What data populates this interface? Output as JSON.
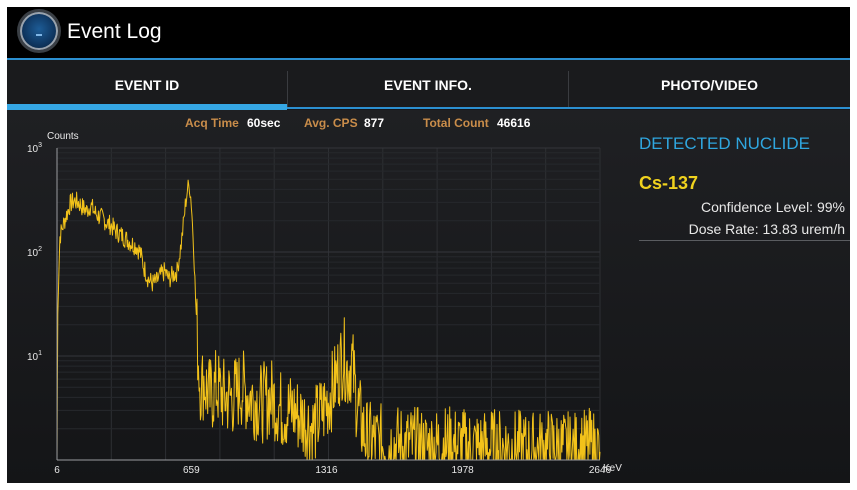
{
  "header": {
    "title": "Event Log",
    "icon": "app-dial-icon"
  },
  "tabs": [
    {
      "label": "EVENT ID",
      "active": true
    },
    {
      "label": "EVENT INFO.",
      "active": false
    },
    {
      "label": "PHOTO/VIDEO",
      "active": false
    }
  ],
  "stats": {
    "acq_time_label": "Acq Time",
    "acq_time_value": "60sec",
    "avg_cps_label": "Avg. CPS",
    "avg_cps_value": "877",
    "total_count_label": "Total Count",
    "total_count_value": "46616"
  },
  "nuclide": {
    "heading": "DETECTED NUCLIDE",
    "name": "Cs-137",
    "confidence": "Confidence Level: 99%",
    "dose_rate": "Dose Rate: 13.83 urem/h"
  },
  "colors": {
    "accent": "#2fa6df",
    "spectrum": "#f2c21a",
    "nuclide": "#f0d21e",
    "stat_label": "#c98d4a"
  },
  "chart_data": {
    "type": "line",
    "ylabel": "Counts",
    "xlabel": "KeV",
    "yscale": "log",
    "y_ticks": [
      {
        "base": "10",
        "exp": "1",
        "value": 10
      },
      {
        "base": "10",
        "exp": "2",
        "value": 100
      },
      {
        "base": "10",
        "exp": "3",
        "value": 1000
      }
    ],
    "x_ticks": [
      "6",
      "659",
      "1316",
      "1978",
      "2646"
    ],
    "xlim": [
      6,
      2646
    ],
    "ylim": [
      1,
      1000
    ],
    "grid": true,
    "series": [
      {
        "x": [
          6,
          10,
          20,
          35,
          50,
          70,
          90,
          110,
          130,
          150,
          170,
          190,
          210,
          230,
          250,
          270,
          290,
          310,
          330,
          350,
          370,
          390,
          410,
          430,
          450,
          470,
          490,
          510,
          530,
          550,
          570,
          590,
          600,
          610,
          620,
          630,
          640,
          650,
          659,
          670,
          680,
          690,
          700,
          710,
          720,
          730,
          750,
          780,
          820,
          860,
          900,
          950,
          1000,
          1050,
          1100,
          1150,
          1200,
          1250,
          1300,
          1350,
          1380,
          1400,
          1420,
          1440,
          1460,
          1480,
          1500,
          1520,
          1550,
          1600,
          1700,
          1800,
          1900,
          2000,
          2100,
          2200,
          2300,
          2400,
          2500,
          2600,
          2646
        ],
        "y": [
          1,
          30,
          140,
          180,
          220,
          290,
          310,
          300,
          270,
          250,
          280,
          240,
          220,
          210,
          190,
          180,
          160,
          150,
          140,
          130,
          120,
          115,
          100,
          70,
          55,
          50,
          52,
          60,
          65,
          55,
          60,
          65,
          90,
          120,
          180,
          280,
          400,
          440,
          300,
          120,
          35,
          12,
          6,
          5,
          6,
          5,
          4,
          5,
          4,
          4,
          5,
          4,
          3.5,
          4,
          3,
          3,
          2.5,
          2,
          3,
          5,
          8,
          10,
          7,
          9,
          4,
          2.5,
          1.8,
          1.5,
          1.5,
          1.4,
          1.4,
          1.3,
          1.4,
          1.3,
          1.3,
          1.3,
          1.2,
          1.3,
          1.2,
          1.3,
          1.2
        ]
      }
    ]
  }
}
